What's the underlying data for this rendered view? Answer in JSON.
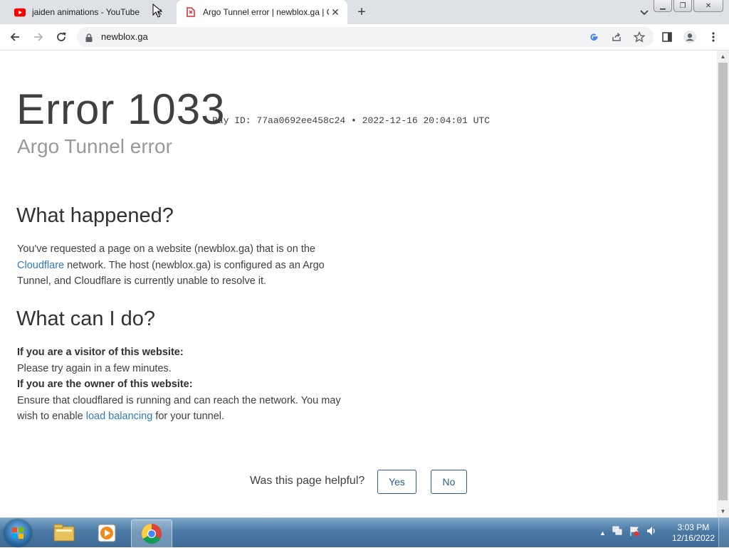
{
  "browser": {
    "tabs": [
      {
        "title": "jaiden animations - YouTube",
        "favicon": "youtube-icon"
      },
      {
        "title": "Argo Tunnel error | newblox.ga | C",
        "favicon": "cloudflare-icon"
      }
    ],
    "url": "newblox.ga"
  },
  "page": {
    "error_code": "Error 1033",
    "ray_id": "Ray ID: 77aa0692ee458c24",
    "ray_sep": "•",
    "timestamp": "2022-12-16 20:04:01 UTC",
    "subtitle": "Argo Tunnel error",
    "what_happened": {
      "heading": "What happened?",
      "text_1": "You've requested a page on a website (newblox.ga) that is on the ",
      "link": "Cloudflare",
      "text_2": " network. The host (newblox.ga) is configured as an Argo Tunnel, and Cloudflare is currently unable to resolve it."
    },
    "what_can_i_do": {
      "heading": "What can I do?",
      "visitor_label": "If you are a visitor of this website:",
      "visitor_text": "Please try again in a few minutes.",
      "owner_label": "If you are the owner of this website:",
      "owner_text_1": "Ensure that cloudflared is running and can reach the network. You may wish to enable ",
      "owner_link": "load balancing",
      "owner_text_2": " for your tunnel."
    },
    "feedback": {
      "question": "Was this page helpful?",
      "yes": "Yes",
      "no": "No"
    }
  },
  "taskbar": {
    "time": "3:03 PM",
    "date": "12/16/2022"
  }
}
